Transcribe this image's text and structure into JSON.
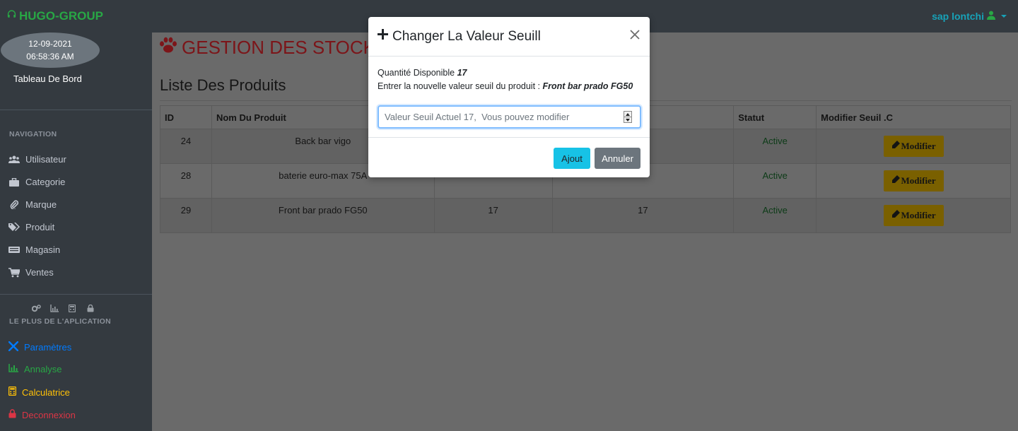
{
  "app": {
    "brand": "HUGO-GROUP",
    "brand_icon": "headset-icon",
    "user": "sap lontchi",
    "colors": {
      "brand": "#28a745",
      "user": "#17a2b8",
      "title": "#dc3545"
    }
  },
  "sidebar": {
    "date": "12-09-2021",
    "time": "06:58:36 AM",
    "dashboard": "Tableau De Bord",
    "nav_heading": "NAVIGATION",
    "items": [
      {
        "label": "Utilisateur",
        "icon": "users-icon"
      },
      {
        "label": "Categorie",
        "icon": "briefcase-icon"
      },
      {
        "label": "Marque",
        "icon": "paperclip-icon"
      },
      {
        "label": "Produit",
        "icon": "tags-icon"
      },
      {
        "label": "Magasin",
        "icon": "store-icon"
      },
      {
        "label": "Ventes",
        "icon": "cart-icon"
      }
    ],
    "plus_heading": "LE PLUS DE L'APLICATION",
    "extras": [
      {
        "label": "Paramètres",
        "icon": "tools-icon",
        "color": "#007bff"
      },
      {
        "label": "Annalyse",
        "icon": "chart-icon",
        "color": "#28a745"
      },
      {
        "label": "Calculatrice",
        "icon": "calculator-icon",
        "color": "#ffc107"
      },
      {
        "label": "Deconnexion",
        "icon": "lock-icon",
        "color": "#dc3545"
      }
    ]
  },
  "main": {
    "page_title": "GESTION DES STOCK",
    "list_title": "Liste Des Produits",
    "table": {
      "headers": [
        "ID",
        "Nom Du Produit",
        "",
        "",
        "Statut",
        "Modifier Seuil .C"
      ],
      "rows": [
        {
          "id": "24",
          "name": "Back bar vigo",
          "qty": "",
          "seuil": "",
          "status": "Active",
          "action": "Modifier"
        },
        {
          "id": "28",
          "name": "baterie euro-max 75A",
          "qty": "",
          "seuil": "",
          "status": "Active",
          "action": "Modifier"
        },
        {
          "id": "29",
          "name": "Front bar prado FG50",
          "qty": "17",
          "seuil": "17",
          "status": "Active",
          "action": "Modifier"
        }
      ]
    }
  },
  "modal": {
    "title": "Changer La Valeur Seuill",
    "qty_label": "Quantité Disponible",
    "qty_value": "17",
    "prompt_label": "Entrer la nouvelle valeur seuil du produit :",
    "product_name": "Front bar prado FG50",
    "input_placeholder": "Valeur Seuil Actuel 17,  Vous pouvez modifier",
    "input_value": "",
    "ok_label": "Ajout",
    "cancel_label": "Annuler"
  }
}
